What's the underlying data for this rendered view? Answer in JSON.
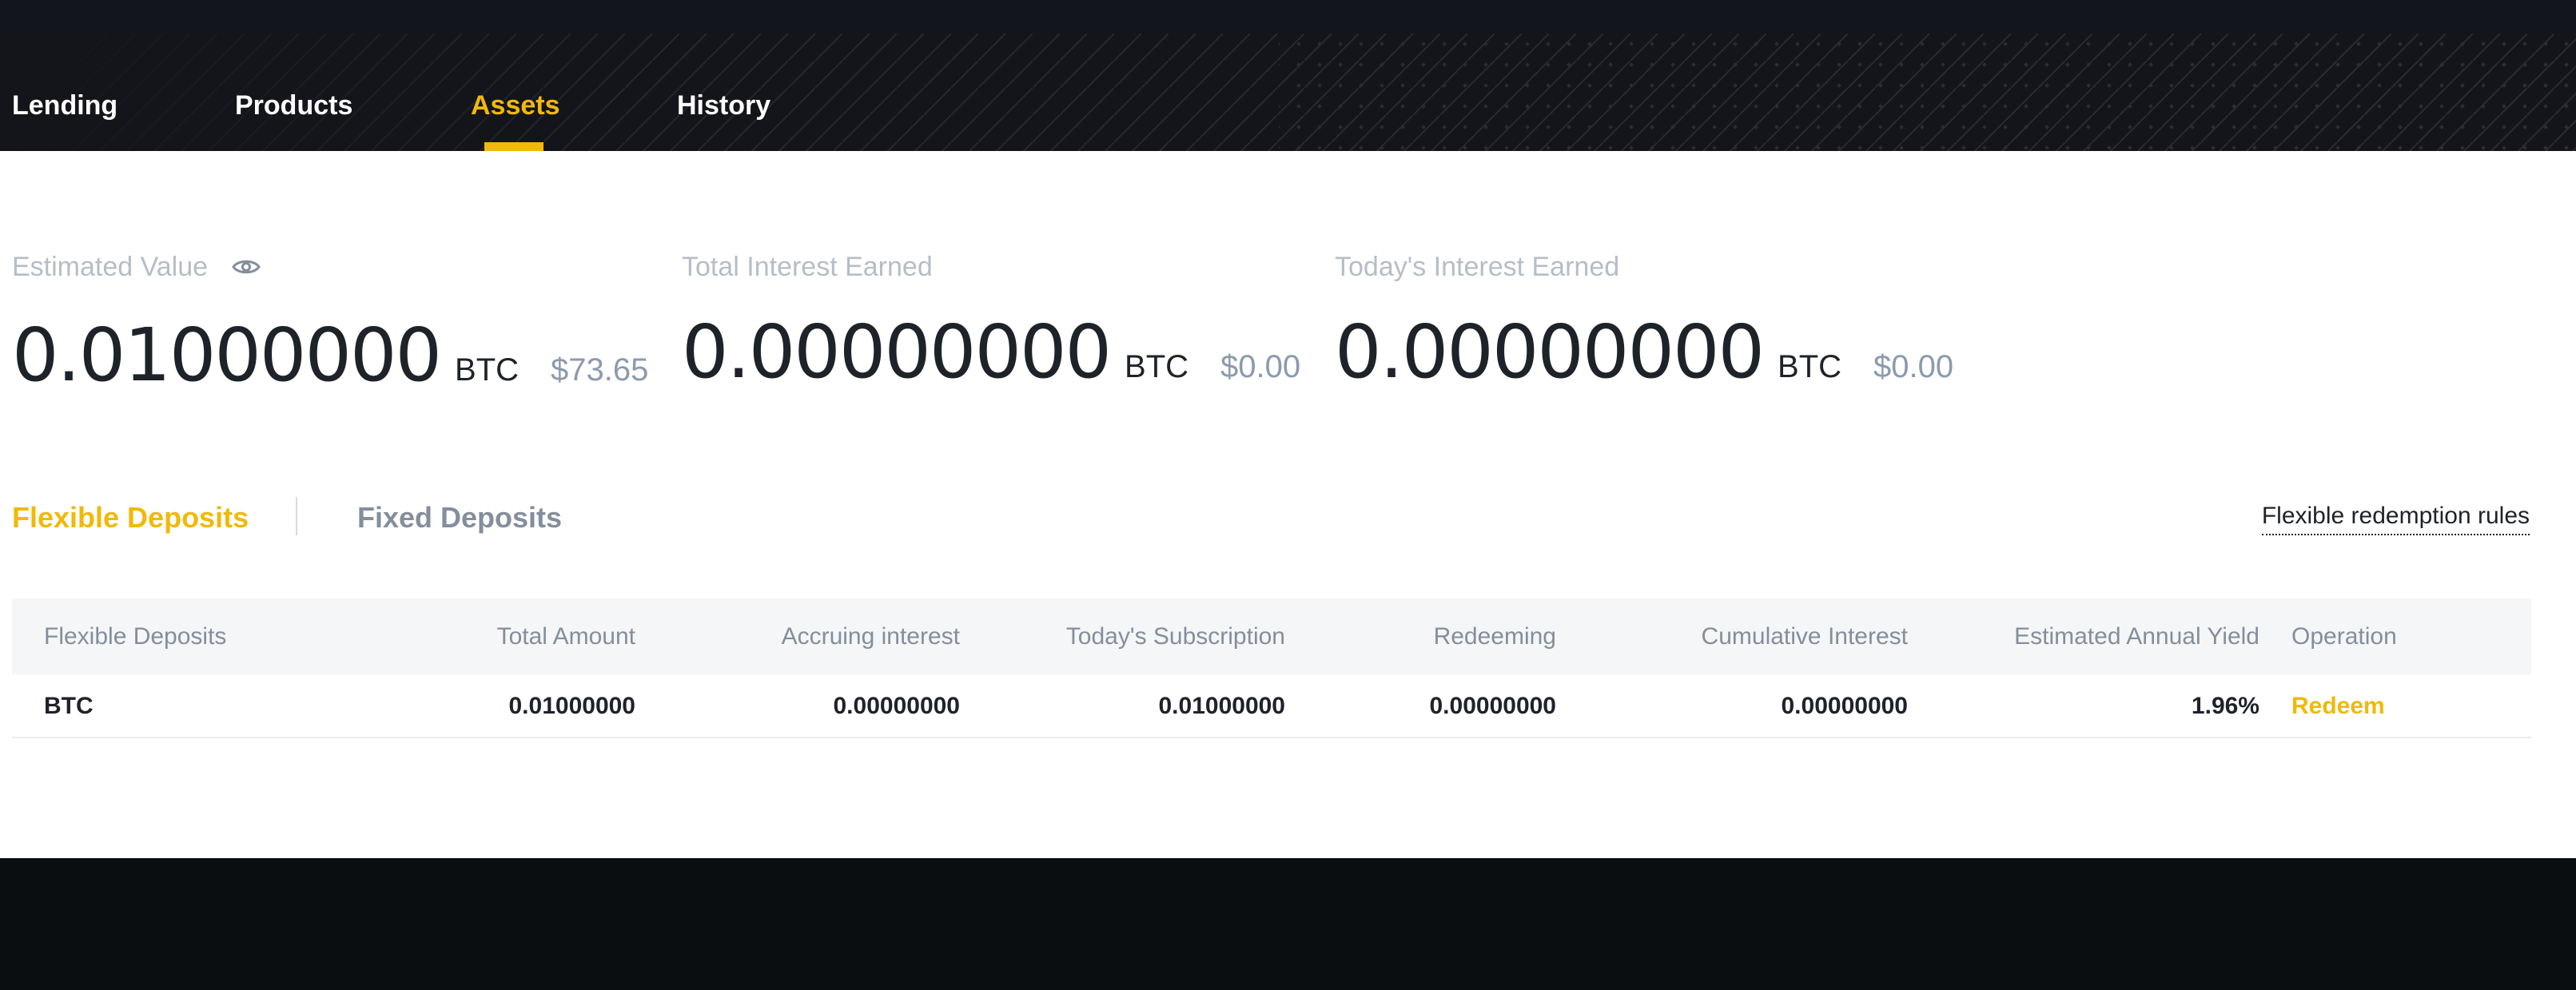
{
  "nav": {
    "items": [
      {
        "label": "Lending",
        "active": false
      },
      {
        "label": "Products",
        "active": false
      },
      {
        "label": "Assets",
        "active": true
      },
      {
        "label": "History",
        "active": false
      }
    ]
  },
  "metrics": [
    {
      "label": "Estimated Value",
      "value": "0.01000000",
      "unit": "BTC",
      "fiat": "$73.65",
      "icon": "eye-icon"
    },
    {
      "label": "Total Interest Earned",
      "value": "0.00000000",
      "unit": "BTC",
      "fiat": "$0.00"
    },
    {
      "label": "Today's Interest Earned",
      "value": "0.00000000",
      "unit": "BTC",
      "fiat": "$0.00"
    }
  ],
  "tabs": {
    "items": [
      {
        "label": "Flexible Deposits",
        "active": true
      },
      {
        "label": "Fixed Deposits",
        "active": false
      }
    ],
    "rules_link": "Flexible redemption rules"
  },
  "table": {
    "columns": [
      "Flexible Deposits",
      "Total Amount",
      "Accruing interest",
      "Today's Subscription",
      "Redeeming",
      "Cumulative Interest",
      "Estimated Annual Yield",
      "Operation"
    ],
    "rows": [
      {
        "asset": "BTC",
        "total_amount": "0.01000000",
        "accruing_interest": "0.00000000",
        "todays_subscription": "0.01000000",
        "redeeming": "0.00000000",
        "cumulative_interest": "0.00000000",
        "annual_yield": "1.96%",
        "operation": "Redeem"
      }
    ]
  },
  "colors": {
    "accent": "#f0b90b",
    "nav_bg": "#14151a",
    "footer_bg": "#0b0e11",
    "text_primary": "#1e2329",
    "text_muted": "#848e9c"
  }
}
